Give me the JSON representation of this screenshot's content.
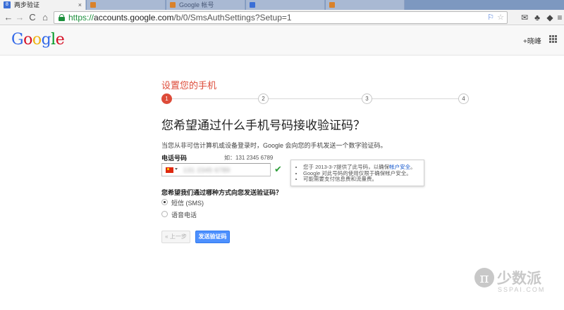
{
  "tabs": [
    {
      "title": "两步验证",
      "close": "×"
    },
    {
      "title": ""
    },
    {
      "title": "Google 帐号"
    },
    {
      "title": ""
    },
    {
      "title": ""
    }
  ],
  "toolbar": {
    "back": "←",
    "forward": "→",
    "reload": "C",
    "home": "⌂",
    "url_scheme": "https://",
    "url_host": "accounts.google.com",
    "url_path": "/b/0/SmsAuthSettings?Setup=1"
  },
  "header": {
    "logo": [
      "G",
      "o",
      "o",
      "g",
      "l",
      "e"
    ],
    "logo_colors": [
      "#3369e8",
      "#d50f25",
      "#eeb211",
      "#3369e8",
      "#009925",
      "#d50f25"
    ],
    "user": "+晓峰"
  },
  "wizard": {
    "title": "设置您的手机",
    "steps": [
      "1",
      "2",
      "3",
      "4"
    ],
    "active_step": 1
  },
  "main": {
    "question": "您希望通过什么手机号码接收验证码？",
    "description": "当您从非可信计算机或设备登录时，Google 会向您的手机发送一个数字验证码。",
    "phone_label": "电话号码",
    "phone_example": "如：131 2345 6789",
    "phone_value": "131 2345 6789",
    "info": {
      "line1_prefix": "您于 2013-3-7提供了此号码，以确保",
      "line1_link": "帐户安全",
      "line1_suffix": "。",
      "line2": "Google 对此号码的使用仅限于确保帐户安全。",
      "line3": "可能需要支付信息费和流量费。"
    },
    "method_question": "您希望我们通过哪种方式向您发送验证码？",
    "methods": [
      {
        "label": "短信 (SMS)",
        "checked": true
      },
      {
        "label": "语音电话",
        "checked": false
      }
    ],
    "prev_button": "« 上一步",
    "send_button": "发送验证码"
  },
  "watermark": {
    "glyph": "π",
    "name": "少数派",
    "domain": "SSPAI.COM"
  },
  "colors": {
    "accent_red": "#dd4b39",
    "primary_blue": "#4d90fe",
    "success_green": "#2e9e3a"
  }
}
